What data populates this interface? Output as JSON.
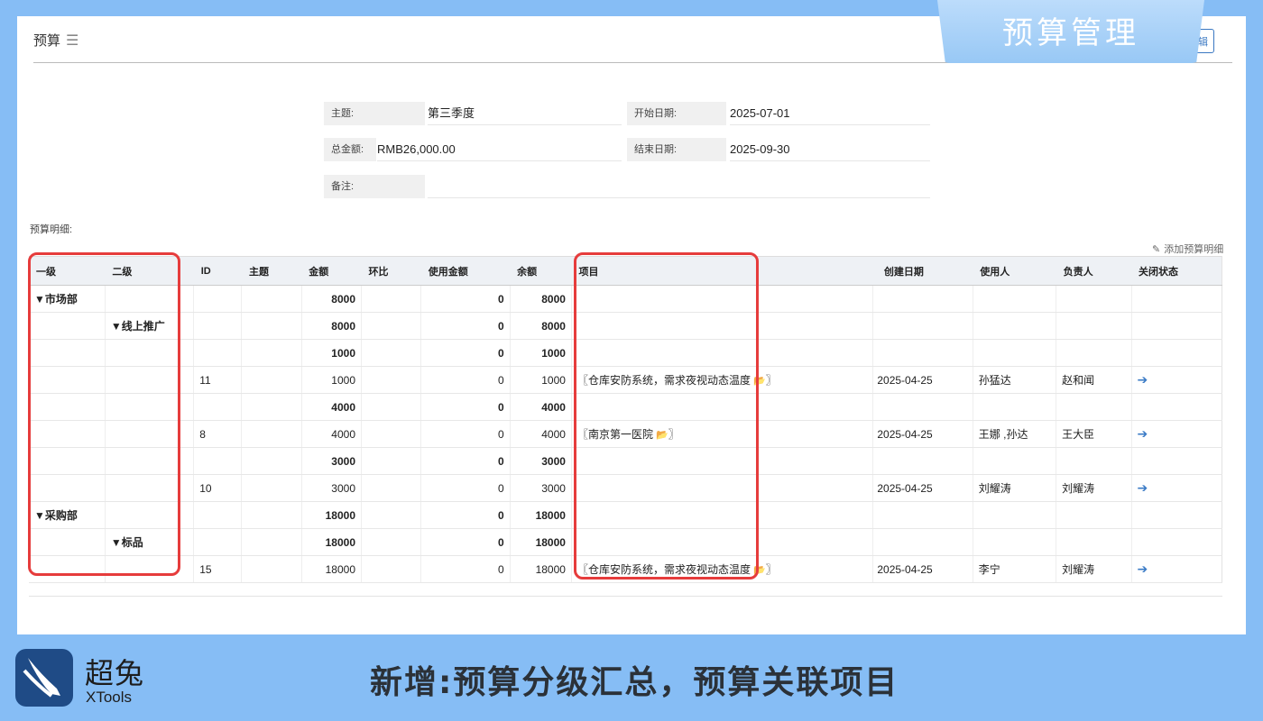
{
  "header": {
    "breadcrumb": "预算",
    "edit_label": "辑",
    "banner_title": "预算管理"
  },
  "form": {
    "subject_label": "主题:",
    "subject_value": "第三季度",
    "start_label": "开始日期:",
    "start_value": "2025-07-01",
    "total_label": "总金额:",
    "total_value": "RMB26,000.00",
    "end_label": "结束日期:",
    "end_value": "2025-09-30",
    "remark_label": "备注:",
    "remark_value": ""
  },
  "detail": {
    "section_title": "预算明细:",
    "add_label": "添加预算明细",
    "columns": [
      "一级",
      "二级",
      "ID",
      "主题",
      "金额",
      "环比",
      "使用金额",
      "余额",
      "项目",
      "创建日期",
      "使用人",
      "负责人",
      "关闭状态"
    ],
    "rows": [
      {
        "l1": "▼市场部",
        "l2": "",
        "id": "",
        "topic": "",
        "amount": "8000",
        "mom": "",
        "used": "0",
        "remain": "8000",
        "project": "",
        "created": "",
        "user": "",
        "owner": "",
        "close": "",
        "bold": true
      },
      {
        "l1": "",
        "l2": "▼线上推广",
        "id": "",
        "topic": "",
        "amount": "8000",
        "mom": "",
        "used": "0",
        "remain": "8000",
        "project": "",
        "created": "",
        "user": "",
        "owner": "",
        "close": "",
        "bold": true
      },
      {
        "l1": "",
        "l2": "",
        "id": "",
        "topic": "",
        "amount": "1000",
        "mom": "",
        "used": "0",
        "remain": "1000",
        "project": "",
        "created": "",
        "user": "",
        "owner": "",
        "close": "",
        "bold": true
      },
      {
        "l1": "",
        "l2": "",
        "id": "11",
        "topic": "",
        "amount": "1000",
        "mom": "",
        "used": "0",
        "remain": "1000",
        "project": "〖仓库安防系统，需求夜视动态温度",
        "created": "2025-04-25",
        "user": "孙猛达",
        "owner": "赵和闻",
        "close": "➔",
        "bold": false
      },
      {
        "l1": "",
        "l2": "",
        "id": "",
        "topic": "",
        "amount": "4000",
        "mom": "",
        "used": "0",
        "remain": "4000",
        "project": "",
        "created": "",
        "user": "",
        "owner": "",
        "close": "",
        "bold": true
      },
      {
        "l1": "",
        "l2": "",
        "id": "8",
        "topic": "",
        "amount": "4000",
        "mom": "",
        "used": "0",
        "remain": "4000",
        "project": "〖南京第一医院",
        "created": "2025-04-25",
        "user": "王娜 ,孙达",
        "owner": "王大臣",
        "close": "➔",
        "bold": false
      },
      {
        "l1": "",
        "l2": "",
        "id": "",
        "topic": "",
        "amount": "3000",
        "mom": "",
        "used": "0",
        "remain": "3000",
        "project": "",
        "created": "",
        "user": "",
        "owner": "",
        "close": "",
        "bold": true
      },
      {
        "l1": "",
        "l2": "",
        "id": "10",
        "topic": "",
        "amount": "3000",
        "mom": "",
        "used": "0",
        "remain": "3000",
        "project": "",
        "created": "2025-04-25",
        "user": "刘耀涛",
        "owner": "刘耀涛",
        "close": "➔",
        "bold": false
      },
      {
        "l1": "▼采购部",
        "l2": "",
        "id": "",
        "topic": "",
        "amount": "18000",
        "mom": "",
        "used": "0",
        "remain": "18000",
        "project": "",
        "created": "",
        "user": "",
        "owner": "",
        "close": "",
        "bold": true
      },
      {
        "l1": "",
        "l2": "▼标品",
        "id": "",
        "topic": "",
        "amount": "18000",
        "mom": "",
        "used": "0",
        "remain": "18000",
        "project": "",
        "created": "",
        "user": "",
        "owner": "",
        "close": "",
        "bold": true
      },
      {
        "l1": "",
        "l2": "",
        "id": "15",
        "topic": "",
        "amount": "18000",
        "mom": "",
        "used": "0",
        "remain": "18000",
        "project": "〖仓库安防系统，需求夜视动态温度",
        "created": "2025-04-25",
        "user": "李宁",
        "owner": "刘耀涛",
        "close": "➔",
        "bold": false
      }
    ]
  },
  "footer": {
    "brand_cn": "超兔",
    "brand_en": "XTools",
    "slogan": "新增:预算分级汇总，预算关联项目"
  },
  "colors": {
    "background": "#86bdf5",
    "accent": "#3b7bc6",
    "highlight": "#e63c3c"
  },
  "icons": [
    "menu-icon",
    "pencil-icon",
    "folder-icon",
    "arrow-right-icon",
    "xtools-logo"
  ]
}
